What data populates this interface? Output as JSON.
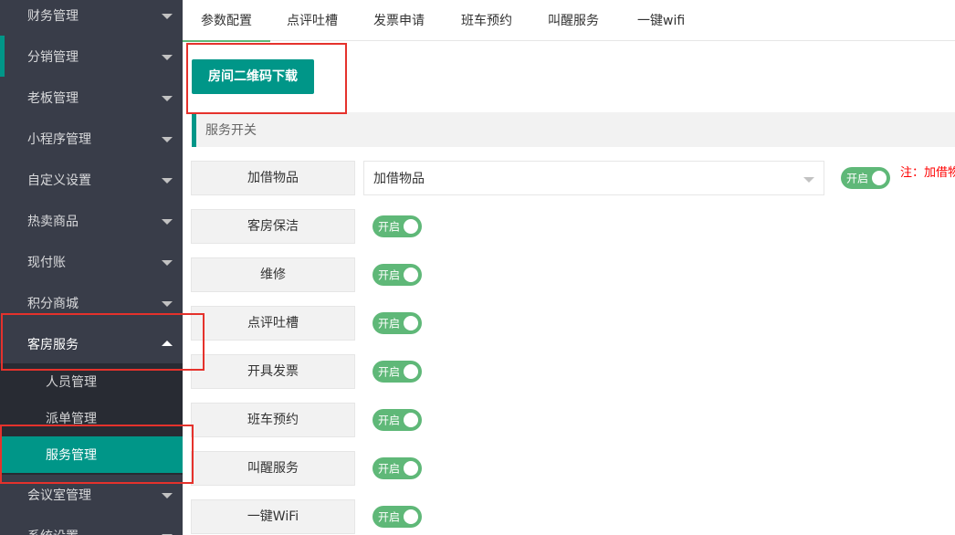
{
  "sidebar": {
    "items": [
      {
        "label": "财务管理"
      },
      {
        "label": "分销管理"
      },
      {
        "label": "老板管理"
      },
      {
        "label": "小程序管理"
      },
      {
        "label": "自定义设置"
      },
      {
        "label": "热卖商品"
      },
      {
        "label": "现付账"
      },
      {
        "label": "积分商城"
      },
      {
        "label": "客房服务"
      },
      {
        "label": "会议室管理"
      },
      {
        "label": "系统设置"
      }
    ],
    "submenu": [
      {
        "label": "人员管理"
      },
      {
        "label": "派单管理"
      },
      {
        "label": "服务管理"
      }
    ]
  },
  "tabs": [
    {
      "label": "参数配置"
    },
    {
      "label": "点评吐槽"
    },
    {
      "label": "发票申请"
    },
    {
      "label": "班车预约"
    },
    {
      "label": "叫醒服务"
    },
    {
      "label": "一键wifi"
    }
  ],
  "main": {
    "qr_button": "房间二维码下载",
    "section_title": "服务开关",
    "borrow": {
      "label": "加借物品",
      "select_value": "加借物品",
      "switch": "开启",
      "note": "注：加借物"
    },
    "rows": [
      {
        "label": "客房保洁",
        "switch": "开启"
      },
      {
        "label": "维修",
        "switch": "开启"
      },
      {
        "label": "点评吐槽",
        "switch": "开启"
      },
      {
        "label": "开具发票",
        "switch": "开启"
      },
      {
        "label": "班车预约",
        "switch": "开启"
      },
      {
        "label": "叫醒服务",
        "switch": "开启"
      },
      {
        "label": "一键WiFi",
        "switch": "开启"
      }
    ]
  },
  "colors": {
    "sidebar_bg": "#393d49",
    "submenu_bg": "#282b33",
    "accent": "#009688",
    "switch_on": "#5fb878",
    "annotation": "#e5322c"
  }
}
